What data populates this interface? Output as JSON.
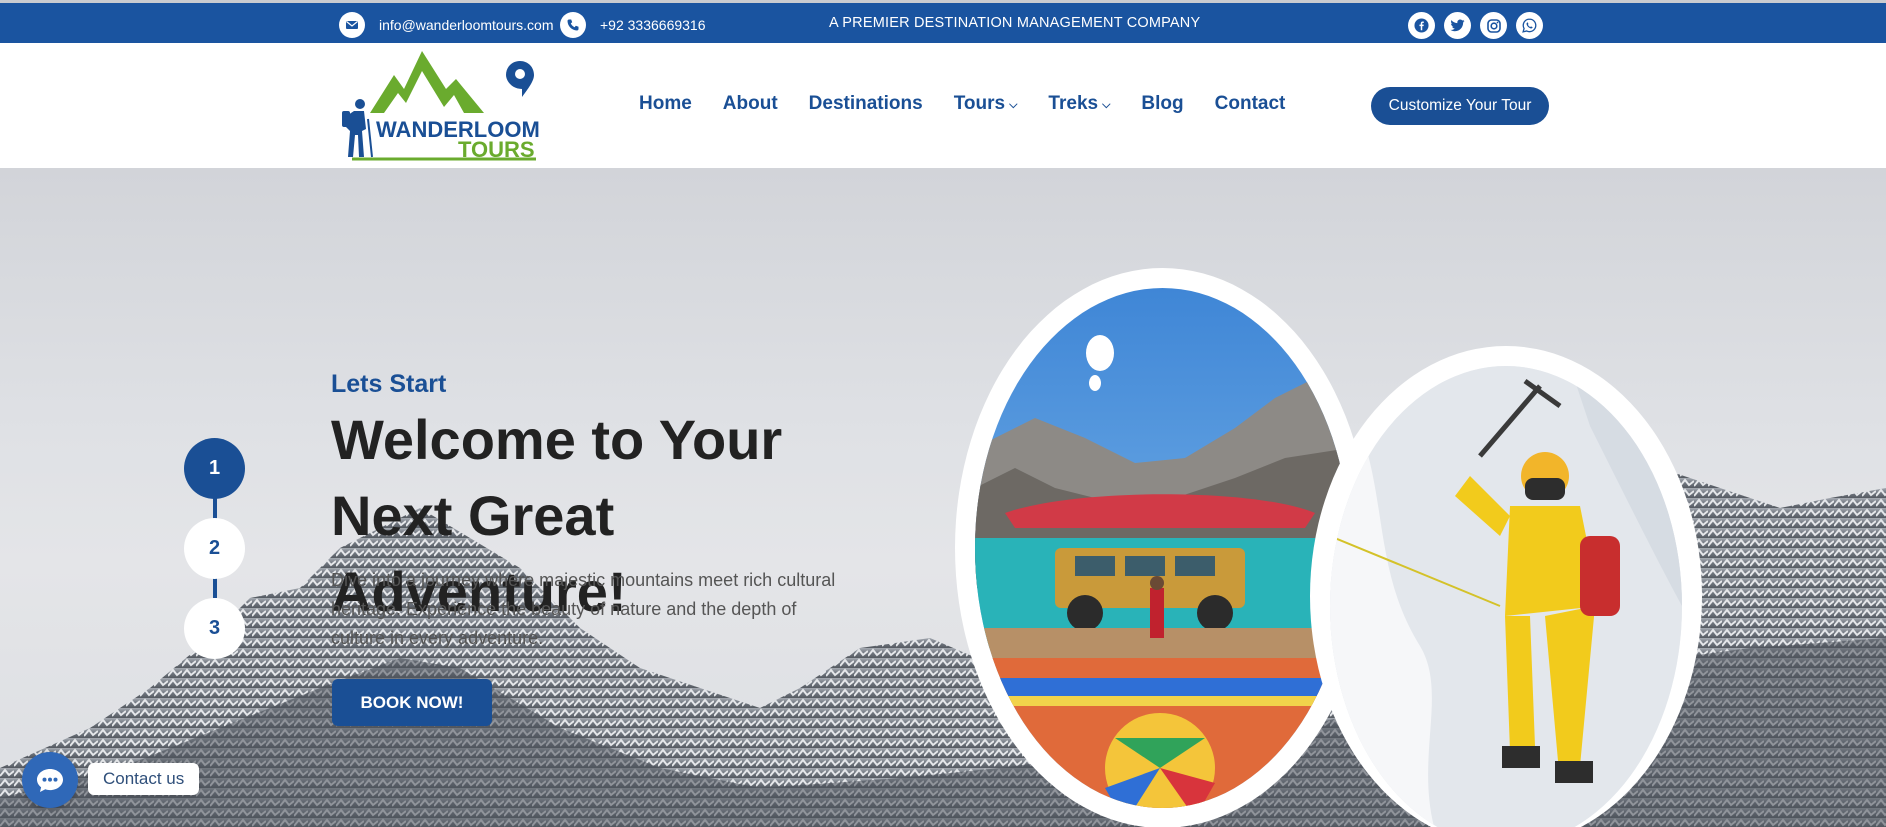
{
  "topbar": {
    "email": "info@wanderloomtours.com",
    "phone": "+92 3336669316",
    "tagline": "A PREMIER DESTINATION MANAGEMENT COMPANY",
    "socials": [
      "facebook-icon",
      "twitter-icon",
      "instagram-icon",
      "whatsapp-icon"
    ]
  },
  "logo": {
    "line1": "WANDERLOOM",
    "line2": "TOURS"
  },
  "nav": {
    "items": [
      {
        "label": "Home",
        "dropdown": false
      },
      {
        "label": "About",
        "dropdown": false
      },
      {
        "label": "Destinations",
        "dropdown": false
      },
      {
        "label": "Tours",
        "dropdown": true
      },
      {
        "label": "Treks",
        "dropdown": true
      },
      {
        "label": "Blog",
        "dropdown": false
      },
      {
        "label": "Contact",
        "dropdown": false
      }
    ],
    "cta": "Customize Your Tour"
  },
  "hero": {
    "steps": [
      "1",
      "2",
      "3"
    ],
    "active_step": "1",
    "kicker": "Lets Start",
    "headline": "Welcome to Your Next Great Adventure!",
    "description": "Dive into a journey where majestic mountains meet rich cultural heritage. Experience the beauty of nature and the depth of culture in every adventure.",
    "button": "BOOK NOW!"
  },
  "chat": {
    "label": "Contact us"
  },
  "colors": {
    "brand_blue": "#1a4f95",
    "logo_green": "#6aab2e",
    "topbar": "#1a54a0"
  }
}
